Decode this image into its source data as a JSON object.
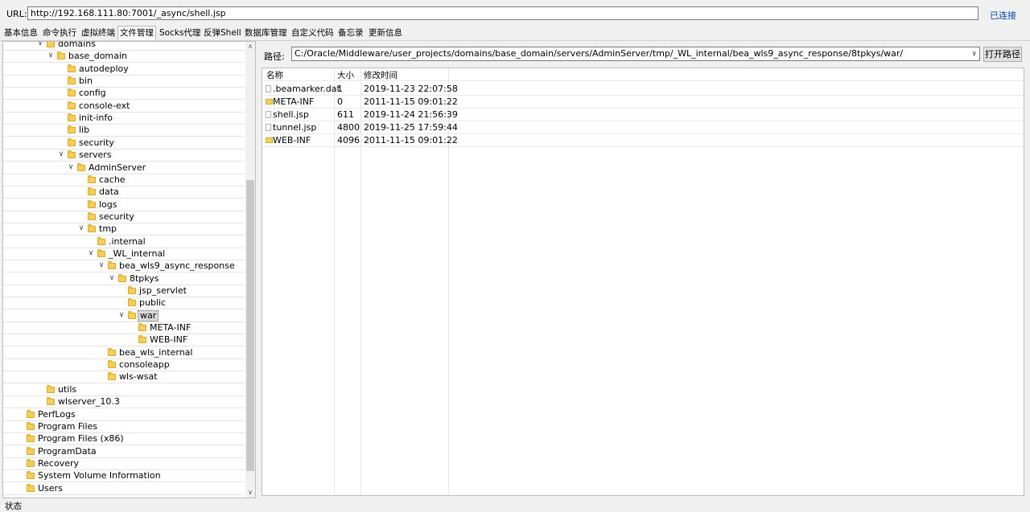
{
  "url_bar": {
    "label": "URL:",
    "value": "http://192.168.111.80:7001/_async/shell.jsp",
    "connection_status": "已连接"
  },
  "tabs": [
    {
      "label": "基本信息"
    },
    {
      "label": "命令执行"
    },
    {
      "label": "虚拟终端"
    },
    {
      "label": "文件管理",
      "active": true
    },
    {
      "label": "Socks代理"
    },
    {
      "label": "反弹Shell"
    },
    {
      "label": "数据库管理"
    },
    {
      "label": "自定义代码"
    },
    {
      "label": "备忘录"
    },
    {
      "label": "更新信息"
    }
  ],
  "tree": [
    {
      "label": "domains",
      "expanded": true
    },
    {
      "label": "base_domain",
      "expanded": true
    },
    {
      "label": "autodeploy"
    },
    {
      "label": "bin"
    },
    {
      "label": "config"
    },
    {
      "label": "console-ext"
    },
    {
      "label": "init-info"
    },
    {
      "label": "lib"
    },
    {
      "label": "security"
    },
    {
      "label": "servers",
      "expanded": true
    },
    {
      "label": "AdminServer",
      "expanded": true
    },
    {
      "label": "cache"
    },
    {
      "label": "data"
    },
    {
      "label": "logs"
    },
    {
      "label": "security"
    },
    {
      "label": "tmp",
      "expanded": true
    },
    {
      "label": ".internal"
    },
    {
      "label": "_WL_internal",
      "expanded": true
    },
    {
      "label": "bea_wls9_async_response",
      "expanded": true
    },
    {
      "label": "8tpkys",
      "expanded": true
    },
    {
      "label": "jsp_servlet"
    },
    {
      "label": "public"
    },
    {
      "label": "war",
      "expanded": true,
      "selected": true
    },
    {
      "label": "META-INF"
    },
    {
      "label": "WEB-INF"
    },
    {
      "label": "bea_wls_internal"
    },
    {
      "label": "consoleapp"
    },
    {
      "label": "wls-wsat"
    },
    {
      "label": "utils"
    },
    {
      "label": "wlserver_10.3"
    },
    {
      "label": "PerfLogs"
    },
    {
      "label": "Program Files"
    },
    {
      "label": "Program Files (x86)"
    },
    {
      "label": "ProgramData"
    },
    {
      "label": "Recovery"
    },
    {
      "label": "System Volume Information"
    },
    {
      "label": "Users"
    }
  ],
  "path": {
    "label": "路径:",
    "value": "C:/Oracle/Middleware/user_projects/domains/base_domain/servers/AdminServer/tmp/_WL_internal/bea_wls9_async_response/8tpkys/war/",
    "open_button": "打开路径"
  },
  "file_list": {
    "columns": [
      "名称",
      "大小",
      "修改时间"
    ],
    "rows": [
      {
        "name": ".beamarker.dat",
        "size": "1",
        "modified": "2019-11-23 22:07:58",
        "type": "file"
      },
      {
        "name": "META-INF",
        "size": "0",
        "modified": "2011-11-15 09:01:22",
        "type": "folder"
      },
      {
        "name": "shell.jsp",
        "size": "611",
        "modified": "2019-11-24 21:56:39",
        "type": "file"
      },
      {
        "name": "tunnel.jsp",
        "size": "4800",
        "modified": "2019-11-25 17:59:44",
        "type": "file"
      },
      {
        "name": "WEB-INF",
        "size": "4096",
        "modified": "2011-11-15 09:01:22",
        "type": "folder"
      }
    ]
  },
  "status_bar": {
    "text": "状态"
  }
}
